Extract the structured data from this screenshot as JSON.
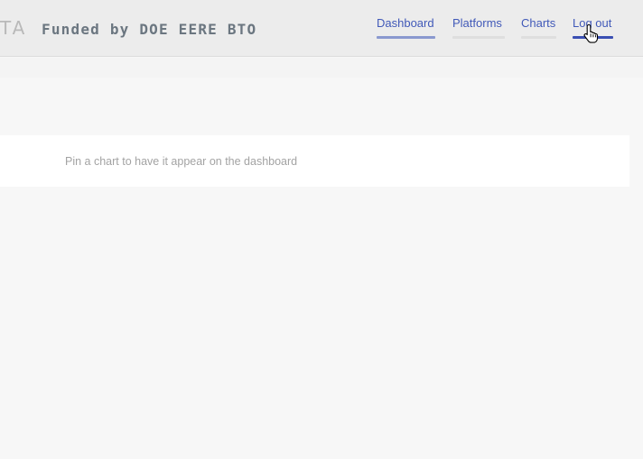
{
  "header": {
    "brand_fragment": "TA",
    "funded_text": "Funded by DOE EERE BTO"
  },
  "nav": {
    "items": [
      {
        "label": "Dashboard"
      },
      {
        "label": "Platforms"
      },
      {
        "label": "Charts"
      },
      {
        "label": "Log out"
      }
    ]
  },
  "dashboard": {
    "empty_message": "Pin a chart to have it appear on the dashboard"
  },
  "colors": {
    "nav_link": "#4159b8",
    "active_underline": "#3a4fb3",
    "header_bg": "#ececec",
    "page_bg": "#f7f7f7"
  },
  "cursor": {
    "icon": "hand-pointer-icon"
  }
}
